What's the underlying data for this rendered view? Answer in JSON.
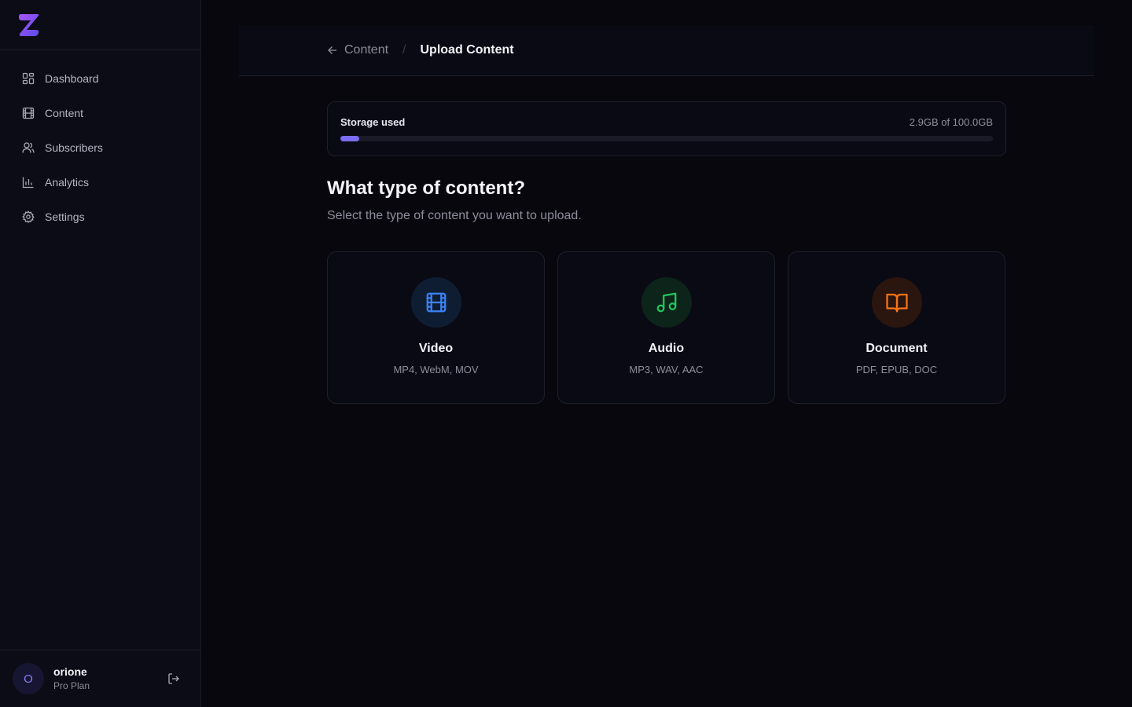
{
  "sidebar": {
    "logo_icon": "z-logo-icon",
    "items": [
      {
        "label": "Dashboard",
        "icon": "dashboard-icon"
      },
      {
        "label": "Content",
        "icon": "film-icon"
      },
      {
        "label": "Subscribers",
        "icon": "users-icon"
      },
      {
        "label": "Analytics",
        "icon": "bar-chart-icon"
      },
      {
        "label": "Settings",
        "icon": "gear-icon"
      }
    ],
    "user": {
      "initial": "O",
      "name": "orione",
      "plan": "Pro Plan",
      "logout_icon": "logout-icon"
    }
  },
  "breadcrumb": {
    "back_label": "Content",
    "separator": "/",
    "current": "Upload Content"
  },
  "storage": {
    "label": "Storage used",
    "value": "2.9GB of 100.0GB",
    "used_fraction": 0.029
  },
  "main": {
    "heading": "What type of content?",
    "subheading": "Select the type of content you want to upload.",
    "cards": [
      {
        "title": "Video",
        "formats": "MP4, WebM, MOV",
        "icon": "film-icon",
        "color": "#3b82f6",
        "bg": "#0f1d33"
      },
      {
        "title": "Audio",
        "formats": "MP3, WAV, AAC",
        "icon": "music-note-icon",
        "color": "#22c55e",
        "bg": "#0c2419"
      },
      {
        "title": "Document",
        "formats": "PDF, EPUB, DOC",
        "icon": "book-icon",
        "color": "#f97316",
        "bg": "#2a160f"
      }
    ]
  },
  "colors": {
    "accent": "#7c6cf6",
    "background": "#07070d"
  }
}
